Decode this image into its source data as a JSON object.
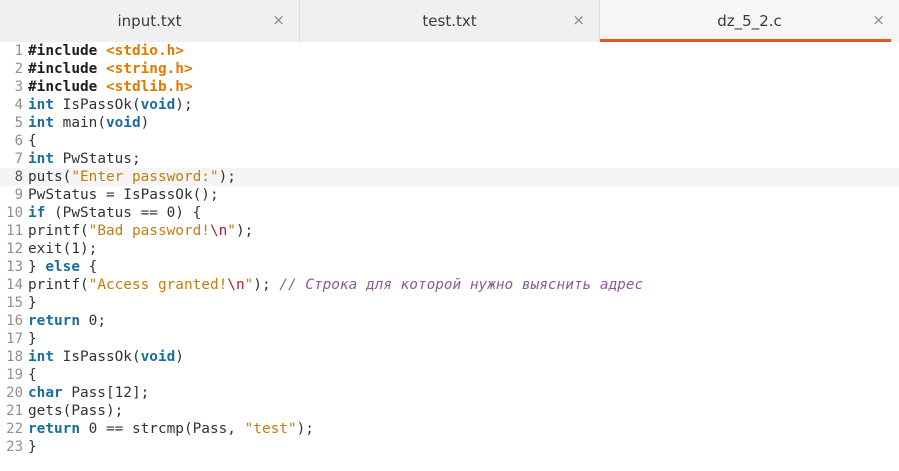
{
  "tabs": [
    {
      "label": "input.txt",
      "active": false,
      "close": "×"
    },
    {
      "label": "test.txt",
      "active": false,
      "close": "×"
    },
    {
      "label": "dz_5_2.c",
      "active": true,
      "close": "×"
    }
  ],
  "editor": {
    "current_line": 8,
    "lines": [
      {
        "n": "1",
        "tokens": [
          {
            "t": "#include",
            "c": "pp"
          },
          {
            "t": " "
          },
          {
            "t": "<stdio.h>",
            "c": "inc"
          }
        ]
      },
      {
        "n": "2",
        "tokens": [
          {
            "t": "#include",
            "c": "pp"
          },
          {
            "t": " "
          },
          {
            "t": "<string.h>",
            "c": "inc"
          }
        ]
      },
      {
        "n": "3",
        "tokens": [
          {
            "t": "#include",
            "c": "pp"
          },
          {
            "t": " "
          },
          {
            "t": "<stdlib.h>",
            "c": "inc"
          }
        ]
      },
      {
        "n": "4",
        "tokens": [
          {
            "t": "int",
            "c": "kw"
          },
          {
            "t": " IsPassOk("
          },
          {
            "t": "void",
            "c": "kw"
          },
          {
            "t": ");"
          }
        ]
      },
      {
        "n": "5",
        "tokens": [
          {
            "t": "int",
            "c": "kw"
          },
          {
            "t": " main("
          },
          {
            "t": "void",
            "c": "kw"
          },
          {
            "t": ")"
          }
        ]
      },
      {
        "n": "6",
        "tokens": [
          {
            "t": "{"
          }
        ]
      },
      {
        "n": "7",
        "tokens": [
          {
            "t": "int",
            "c": "kw"
          },
          {
            "t": " PwStatus;"
          }
        ]
      },
      {
        "n": "8",
        "tokens": [
          {
            "t": "puts("
          },
          {
            "t": "\"Enter password:\"",
            "c": "str"
          },
          {
            "t": ");"
          }
        ]
      },
      {
        "n": "9",
        "tokens": [
          {
            "t": "PwStatus = IsPassOk();"
          }
        ]
      },
      {
        "n": "10",
        "tokens": [
          {
            "t": "if",
            "c": "kw"
          },
          {
            "t": " (PwStatus == "
          },
          {
            "t": "0",
            "c": "num"
          },
          {
            "t": ") {"
          }
        ]
      },
      {
        "n": "11",
        "tokens": [
          {
            "t": "printf("
          },
          {
            "t": "\"Bad password!",
            "c": "str"
          },
          {
            "t": "\\n",
            "c": "esc"
          },
          {
            "t": "\"",
            "c": "str"
          },
          {
            "t": ");"
          }
        ]
      },
      {
        "n": "12",
        "tokens": [
          {
            "t": "exit("
          },
          {
            "t": "1",
            "c": "num"
          },
          {
            "t": ");"
          }
        ]
      },
      {
        "n": "13",
        "tokens": [
          {
            "t": "} "
          },
          {
            "t": "else",
            "c": "kw"
          },
          {
            "t": " {"
          }
        ]
      },
      {
        "n": "14",
        "tokens": [
          {
            "t": "printf("
          },
          {
            "t": "\"Access granted!",
            "c": "str"
          },
          {
            "t": "\\n",
            "c": "esc"
          },
          {
            "t": "\"",
            "c": "str"
          },
          {
            "t": "); "
          },
          {
            "t": "// Строка для которой нужно выяснить адрес",
            "c": "cmt"
          }
        ]
      },
      {
        "n": "15",
        "tokens": [
          {
            "t": "}"
          }
        ]
      },
      {
        "n": "16",
        "tokens": [
          {
            "t": "return",
            "c": "kw"
          },
          {
            "t": " "
          },
          {
            "t": "0",
            "c": "num"
          },
          {
            "t": ";"
          }
        ]
      },
      {
        "n": "17",
        "tokens": [
          {
            "t": "}"
          }
        ]
      },
      {
        "n": "18",
        "tokens": [
          {
            "t": "int",
            "c": "kw"
          },
          {
            "t": " IsPassOk("
          },
          {
            "t": "void",
            "c": "kw"
          },
          {
            "t": ")"
          }
        ]
      },
      {
        "n": "19",
        "tokens": [
          {
            "t": "{"
          }
        ]
      },
      {
        "n": "20",
        "tokens": [
          {
            "t": "char",
            "c": "kw"
          },
          {
            "t": " Pass["
          },
          {
            "t": "12",
            "c": "num"
          },
          {
            "t": "];"
          }
        ]
      },
      {
        "n": "21",
        "tokens": [
          {
            "t": "gets(Pass);"
          }
        ]
      },
      {
        "n": "22",
        "tokens": [
          {
            "t": "return",
            "c": "kw"
          },
          {
            "t": " "
          },
          {
            "t": "0",
            "c": "num"
          },
          {
            "t": " == strcmp(Pass, "
          },
          {
            "t": "\"test\"",
            "c": "str"
          },
          {
            "t": ");"
          }
        ]
      },
      {
        "n": "23",
        "tokens": [
          {
            "t": "}"
          }
        ]
      }
    ]
  },
  "colors": {
    "accent": "#e95420",
    "keyword": "#1a6e99",
    "include": "#e07a00",
    "string": "#c17d11",
    "escape": "#c4162a",
    "comment": "#8e5a9c"
  }
}
